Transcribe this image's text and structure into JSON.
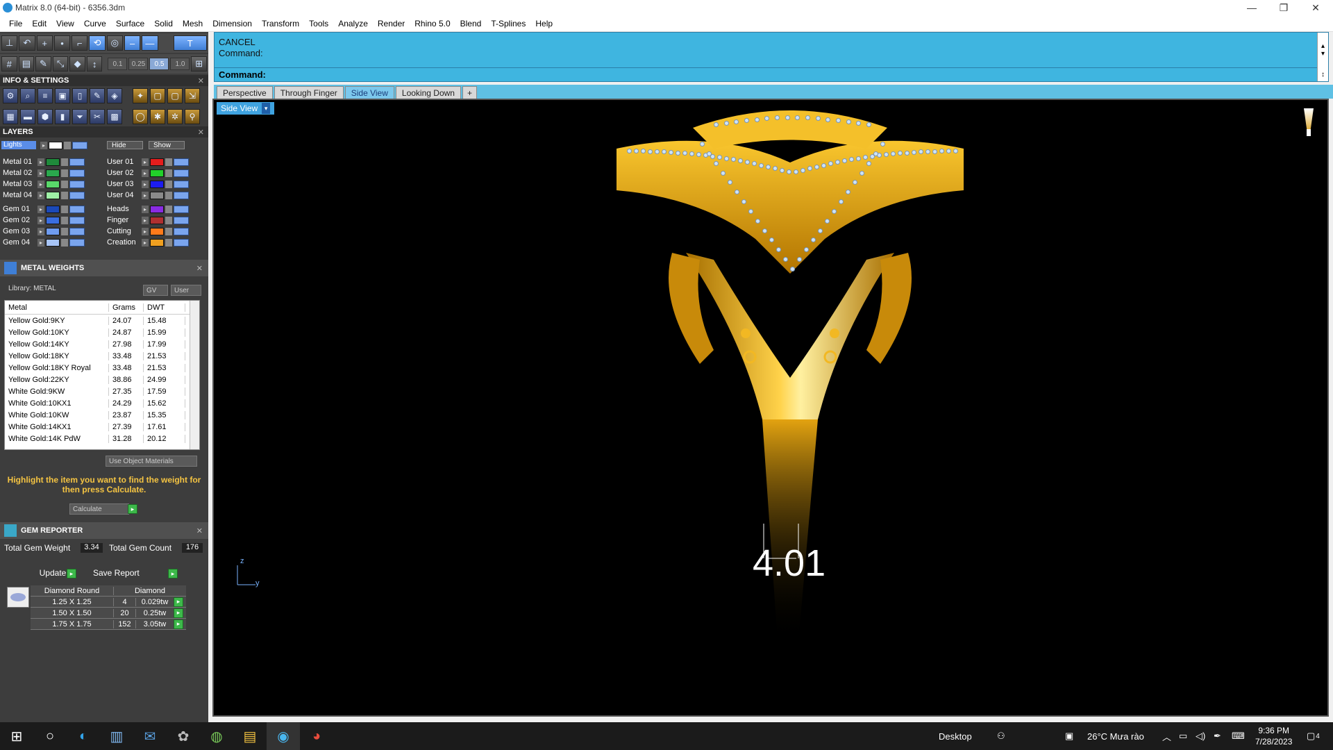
{
  "window": {
    "title": "Matrix 8.0 (64-bit) - 6356.3dm",
    "minimize": "—",
    "restore": "❐",
    "close": "✕"
  },
  "menu": [
    "File",
    "Edit",
    "View",
    "Curve",
    "Surface",
    "Solid",
    "Mesh",
    "Dimension",
    "Transform",
    "Tools",
    "Analyze",
    "Render",
    "Rhino 5.0",
    "Blend",
    "T-Splines",
    "Help"
  ],
  "snap_values": [
    "0.1",
    "0.25",
    "0.5",
    "1.0"
  ],
  "info_settings": {
    "title": "INFO & SETTINGS",
    "close": "✕"
  },
  "layers": {
    "title": "LAYERS",
    "close": "✕",
    "lights": "Lights",
    "hide": "Hide",
    "show": "Show",
    "left": [
      {
        "name": "Metal 01",
        "color": "#1f8a3b"
      },
      {
        "name": "Metal 02",
        "color": "#2aa84d"
      },
      {
        "name": "Metal 03",
        "color": "#59d86a"
      },
      {
        "name": "Metal 04",
        "color": "#9ff0a6"
      },
      {
        "name": "Gem 01",
        "color": "#1b49b8"
      },
      {
        "name": "Gem 02",
        "color": "#3a6ee0"
      },
      {
        "name": "Gem 03",
        "color": "#6f9cf0"
      },
      {
        "name": "Gem 04",
        "color": "#a7c4f6"
      }
    ],
    "right": [
      {
        "name": "User 01",
        "color": "#e51d1d"
      },
      {
        "name": "User 02",
        "color": "#22d12a"
      },
      {
        "name": "User 03",
        "color": "#1c1cf0"
      },
      {
        "name": "User 04",
        "color": "#8a8a8a"
      },
      {
        "name": "Heads",
        "color": "#8a2be2"
      },
      {
        "name": "Finger",
        "color": "#b03030"
      },
      {
        "name": "Cutting",
        "color": "#ff7a1a"
      },
      {
        "name": "Creation",
        "color": "#f0a020"
      }
    ]
  },
  "metal_weights": {
    "title": "METAL WEIGHTS",
    "close": "✕",
    "library": "Library: METAL",
    "gv": "GV",
    "user": "User",
    "columns": [
      "Metal",
      "Grams",
      "DWT"
    ],
    "rows": [
      [
        "Yellow Gold:9KY",
        "24.07",
        "15.48"
      ],
      [
        "Yellow Gold:10KY",
        "24.87",
        "15.99"
      ],
      [
        "Yellow Gold:14KY",
        "27.98",
        "17.99"
      ],
      [
        "Yellow Gold:18KY",
        "33.48",
        "21.53"
      ],
      [
        "Yellow Gold:18KY Royal",
        "33.48",
        "21.53"
      ],
      [
        "Yellow Gold:22KY",
        "38.86",
        "24.99"
      ],
      [
        "White Gold:9KW",
        "27.35",
        "17.59"
      ],
      [
        "White Gold:10KX1",
        "24.29",
        "15.62"
      ],
      [
        "White Gold:10KW",
        "23.87",
        "15.35"
      ],
      [
        "White Gold:14KX1",
        "27.39",
        "17.61"
      ],
      [
        "White Gold:14K PdW",
        "31.28",
        "20.12"
      ]
    ],
    "use_object_materials": "Use Object Materials",
    "hint": "Highlight the item you want to find the weight for then press Calculate.",
    "calculate": "Calculate"
  },
  "gem_reporter": {
    "title": "GEM REPORTER",
    "close": "✕",
    "total_weight_label": "Total Gem Weight",
    "total_weight": "3.34",
    "total_count_label": "Total Gem Count",
    "total_count": "176",
    "update": "Update",
    "save_report": "Save Report",
    "headers": [
      "Diamond Round",
      "Diamond"
    ],
    "rows": [
      [
        "1.25 X 1.25",
        "4",
        "0.029tw"
      ],
      [
        "1.50 X 1.50",
        "20",
        "0.25tw"
      ],
      [
        "1.75 X 1.75",
        "152",
        "3.05tw"
      ]
    ]
  },
  "command": {
    "line1": "CANCEL",
    "line2": "Command:",
    "prompt": "Command:"
  },
  "view_tabs": [
    "Perspective",
    "Through Finger",
    "Side View",
    "Looking Down",
    "+"
  ],
  "active_view": "Side View",
  "viewport_label": "Side View",
  "axis": {
    "z": "z",
    "y": "y"
  },
  "dimension": "4.01",
  "taskbar": {
    "desktop": "Desktop",
    "weather": "26°C  Mưa rào",
    "time": "9:36 PM",
    "date": "7/28/2023",
    "notifications": "4"
  }
}
